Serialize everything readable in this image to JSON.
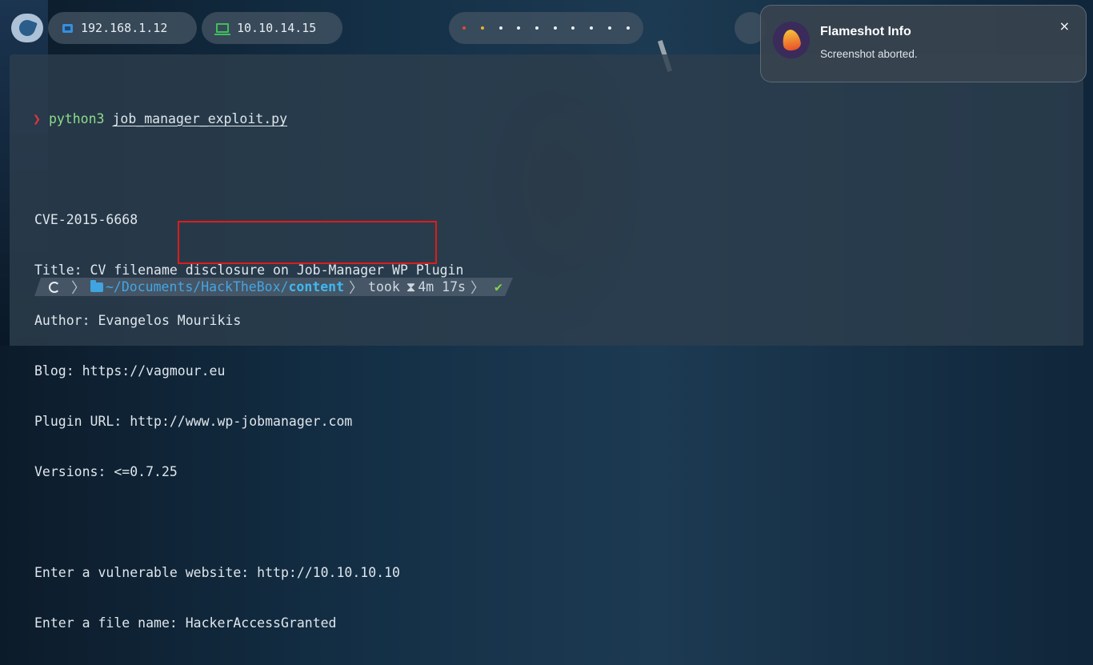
{
  "topbar": {
    "ip_local": "192.168.1.12",
    "ip_vpn": "10.10.14.15",
    "workspaces": [
      "red",
      "yellow",
      "white",
      "white",
      "white",
      "white",
      "white",
      "white",
      "white",
      "white"
    ]
  },
  "terminal": {
    "prompt_symbol": "❯",
    "command": "python3",
    "command_arg": "job_manager_exploit.py",
    "output_lines": [
      "CVE-2015-6668",
      "Title: CV filename disclosure on Job-Manager WP Plugin",
      "Author: Evangelos Mourikis",
      "Blog: https://vagmour.eu",
      "Plugin URL: http://www.wp-jobmanager.com",
      "Versions: <=0.7.25"
    ],
    "input_lines": [
      {
        "label": "Enter a vulnerable website: ",
        "value": "http://10.10.10.10"
      },
      {
        "label": "Enter a file name: ",
        "value": "HackerAccessGranted"
      }
    ],
    "prompt_bar": {
      "path_prefix": "~/Documents/HackTheBox/",
      "path_last": "content",
      "took_label": "took",
      "duration": "4m 17s",
      "status": "✔"
    }
  },
  "notification": {
    "title": "Flameshot Info",
    "body": "Screenshot aborted.",
    "close": "×"
  },
  "colors": {
    "accent_red": "#e01b1b",
    "path_blue": "#42a6e6",
    "command_green": "#8ddc8a",
    "status_green": "#7cd64a"
  }
}
